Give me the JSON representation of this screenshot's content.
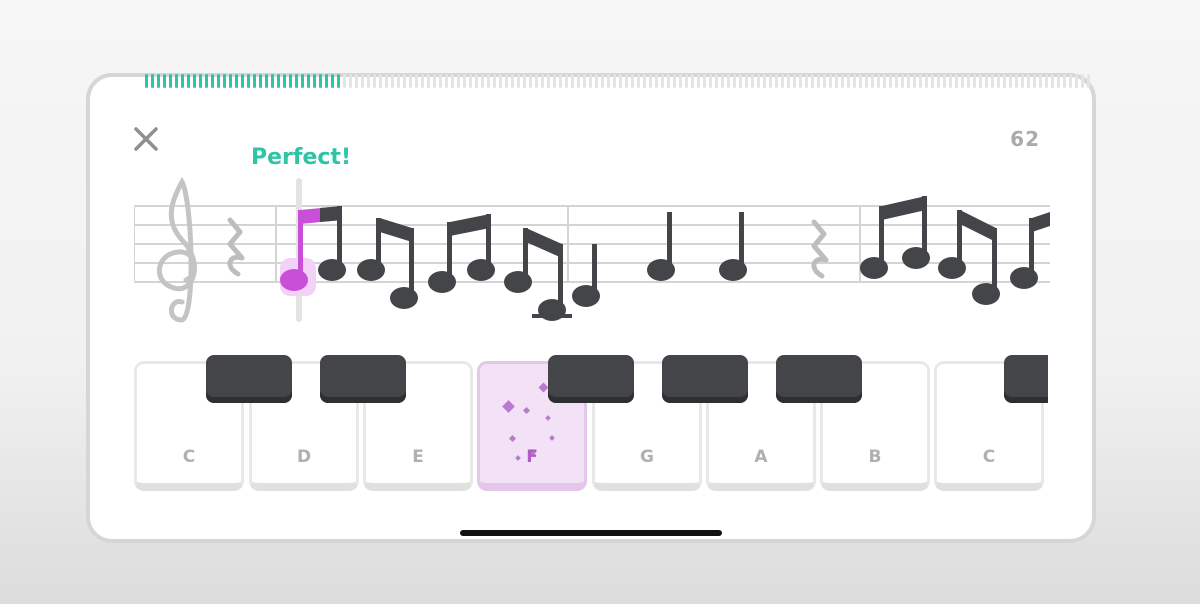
{
  "header": {
    "note_count": "62",
    "feedback": "Perfect!"
  },
  "icons": {
    "close": "close-icon",
    "clef": "treble-clef-icon"
  },
  "lesson_progress": 0.21,
  "keyboard": {
    "white_keys": [
      "C",
      "D",
      "E",
      "F",
      "G",
      "A",
      "B",
      "C"
    ],
    "active_key": "F"
  },
  "colors": {
    "accent_green": "#2ec4a5",
    "highlight_purple": "#c94fd8",
    "note_dark": "#444548",
    "staff_line": "#d4d4d4"
  }
}
